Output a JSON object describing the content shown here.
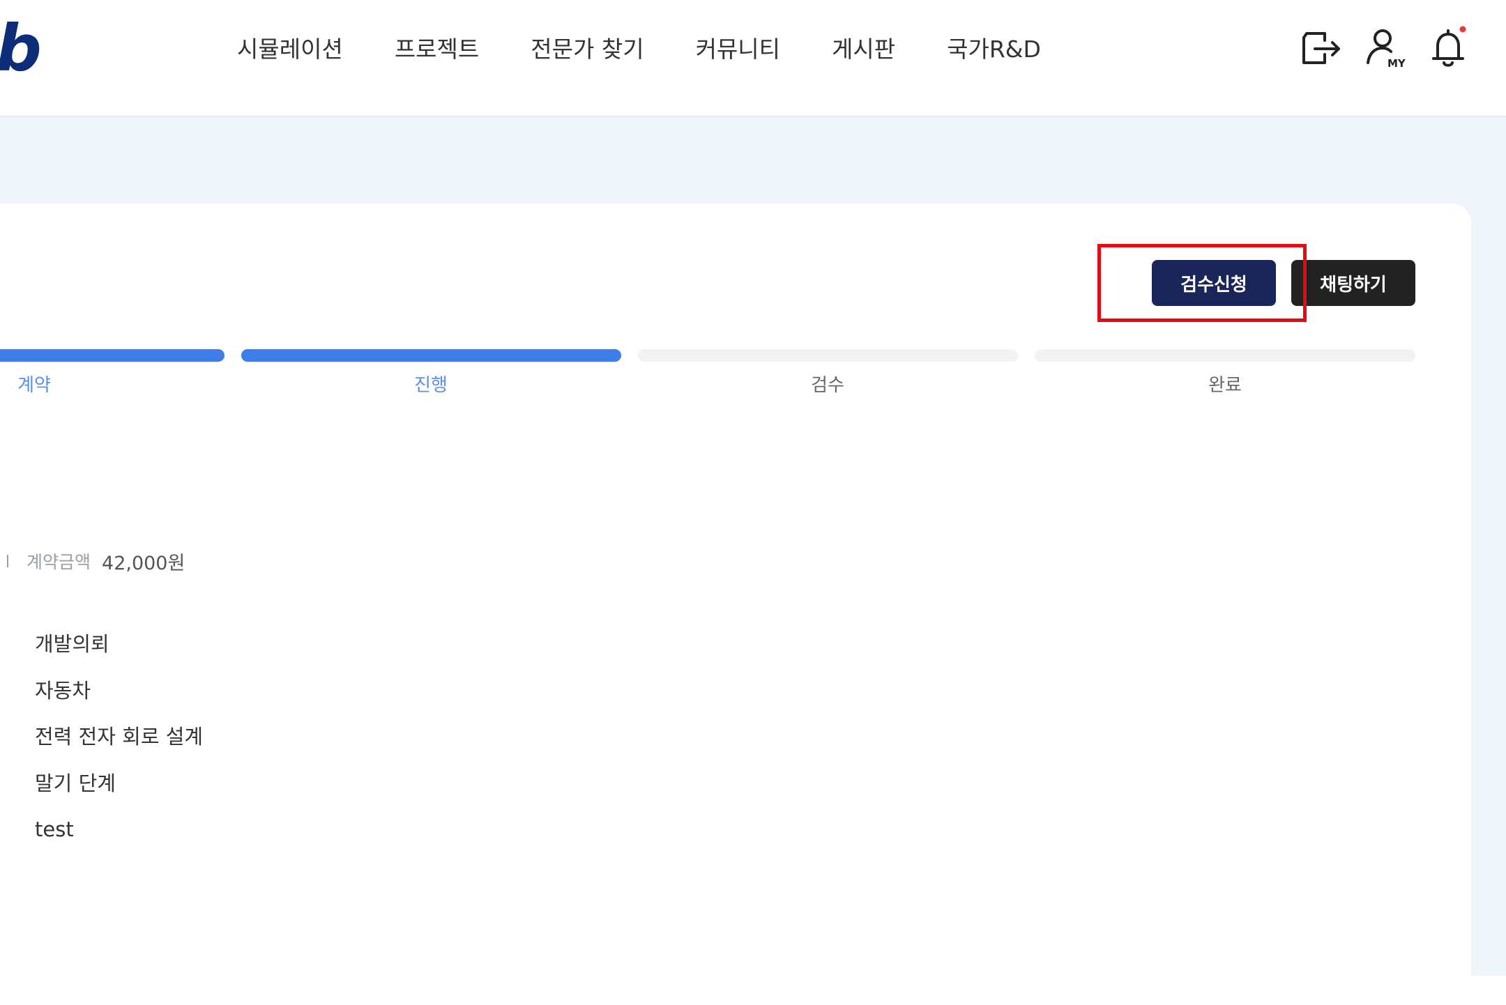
{
  "header": {
    "logo_text": "b",
    "nav": [
      {
        "label": "시뮬레이션"
      },
      {
        "label": "프로젝트"
      },
      {
        "label": "전문가 찾기"
      },
      {
        "label": "커뮤니티"
      },
      {
        "label": "게시판"
      },
      {
        "label": "국가R&D"
      }
    ],
    "icons": [
      "logout-icon",
      "my-page-icon",
      "notification-bell-icon"
    ],
    "my_icon_badge": "MY",
    "notification_dot_color": "#e53935",
    "logo_color": "#0d2d7a"
  },
  "actions": {
    "inspect_request_label": "검수신청",
    "chat_label": "채팅하기",
    "inspect_button_color": "#1a2559",
    "chat_button_color": "#222222",
    "highlight_color": "#e50914"
  },
  "progress": {
    "steps": [
      {
        "label": "계약",
        "state": "active"
      },
      {
        "label": "진행",
        "state": "active"
      },
      {
        "label": "검수",
        "state": "inactive"
      },
      {
        "label": "완료",
        "state": "inactive"
      }
    ],
    "active_color": "#3f7de8",
    "inactive_color": "#f2f3f5"
  },
  "contract": {
    "amount_label": "계약금액",
    "amount_value": "42,000원"
  },
  "details": [
    {
      "value": "개발의뢰"
    },
    {
      "value": "자동차"
    },
    {
      "value": "전력 전자 회로 설계"
    },
    {
      "value": "말기 단계"
    },
    {
      "value": "test"
    }
  ]
}
